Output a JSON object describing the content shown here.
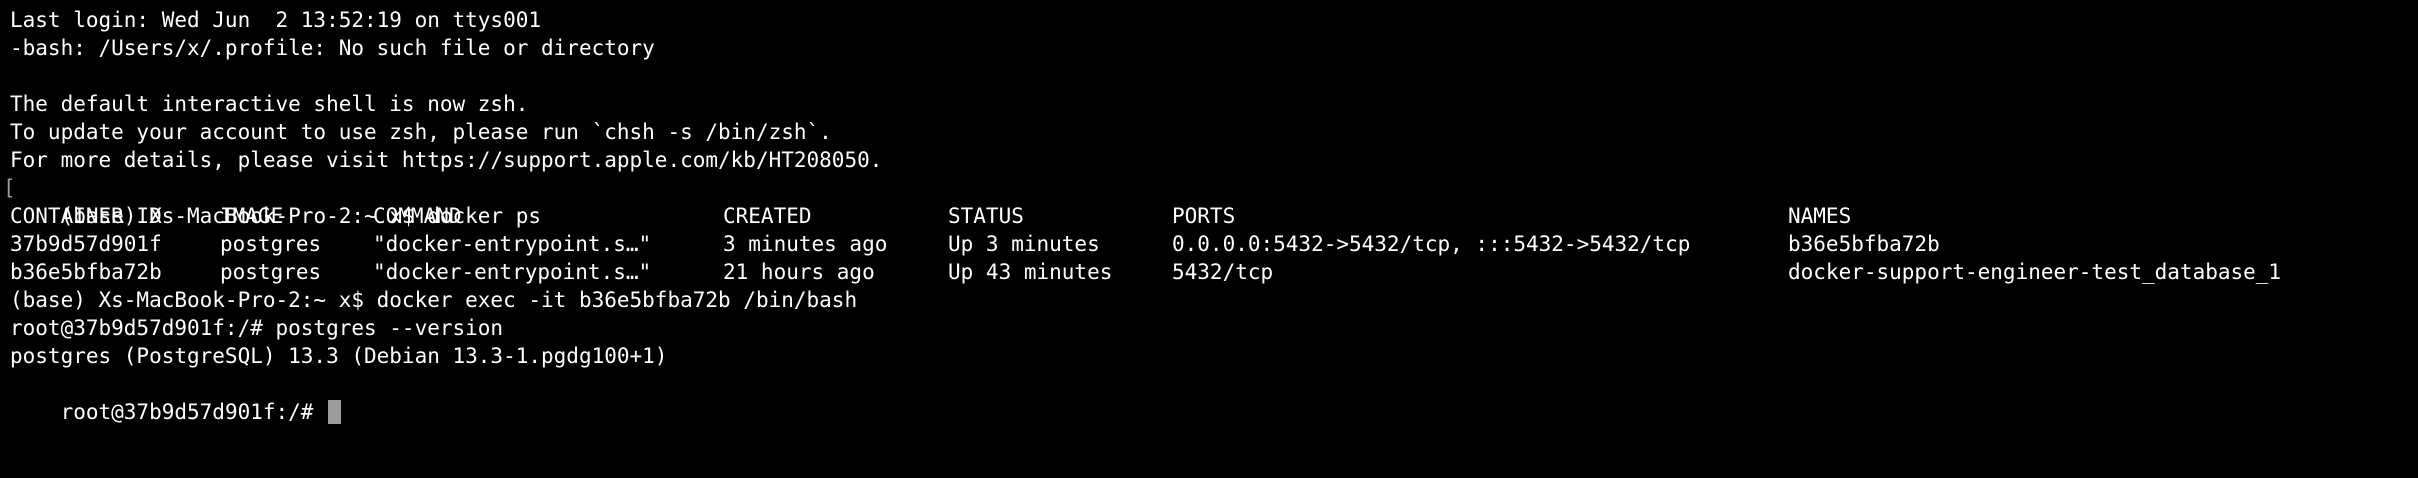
{
  "terminal": {
    "login": "Last login: Wed Jun  2 13:52:19 on ttys001",
    "profile_error": "-bash: /Users/x/.profile: No such file or directory",
    "notice_shell": "The default interactive shell is now zsh.",
    "notice_update": "To update your account to use zsh, please run `chsh -s /bin/zsh`.",
    "notice_details": "For more details, please visit https://support.apple.com/kb/HT208050.",
    "cmd_ps": "(base) Xs-MacBook-Pro-2:~ x$ docker ps",
    "ps_table": {
      "headers": [
        "CONTAINER ID",
        "IMAGE",
        "COMMAND",
        "CREATED",
        "STATUS",
        "PORTS",
        "NAMES"
      ],
      "rows": [
        [
          "37b9d57d901f",
          "postgres",
          "\"docker-entrypoint.s…\"",
          "3 minutes ago",
          "Up 3 minutes",
          "0.0.0.0:5432->5432/tcp, :::5432->5432/tcp",
          "b36e5bfba72b"
        ],
        [
          "b36e5bfba72b",
          "postgres",
          "\"docker-entrypoint.s…\"",
          "21 hours ago",
          "Up 43 minutes",
          "5432/tcp",
          "docker-support-engineer-test_database_1"
        ]
      ]
    },
    "cmd_exec": "(base) Xs-MacBook-Pro-2:~ x$ docker exec -it b36e5bfba72b /bin/bash",
    "cmd_version": "root@37b9d57d901f:/# postgres --version",
    "version_output": "postgres (PostgreSQL) 13.3 (Debian 13.3-1.pgdg100+1)",
    "current_prompt": "root@37b9d57d901f:/# ",
    "mark_glyph": "["
  }
}
